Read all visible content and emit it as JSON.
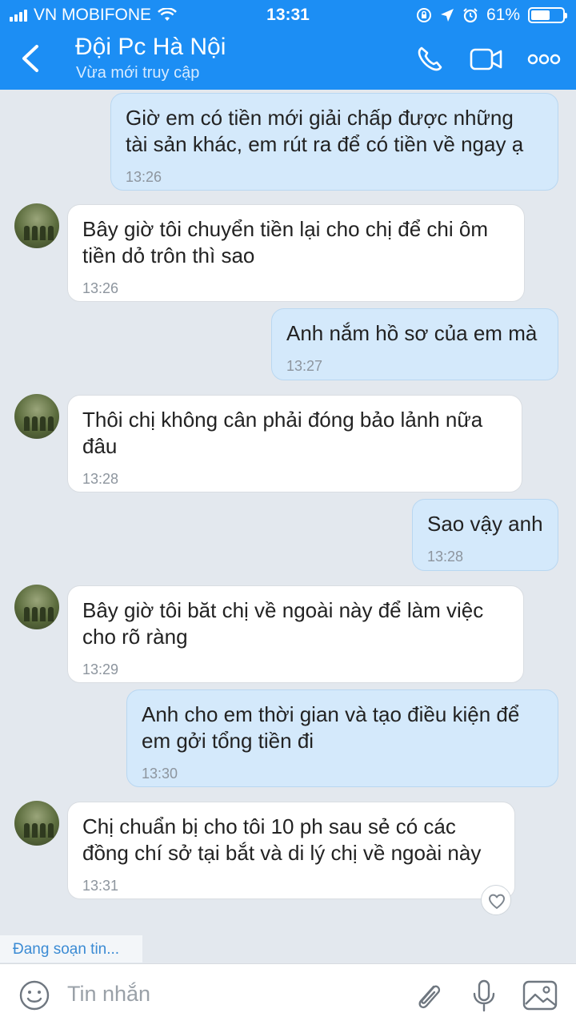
{
  "status": {
    "carrier": "VN MOBIFONE",
    "time": "13:31",
    "battery": "61%",
    "battery_level": 0.61
  },
  "header": {
    "title": "Đội  Pc Hà Nội",
    "subtitle": "Vừa mới truy cập"
  },
  "messages": [
    {
      "from": "me",
      "text": "Giờ em có tiền mới giải chấp được những\ntài sản khác, em rút ra để có tiền về ngay ạ",
      "time": "13:26"
    },
    {
      "from": "them",
      "text": "Bây giờ tôi chuyển tiền lại cho chị để chi ôm\ntiền dỏ trôn thì sao",
      "time": "13:26"
    },
    {
      "from": "me",
      "text": "Anh nắm hồ sơ của em mà",
      "time": "13:27"
    },
    {
      "from": "them",
      "text": "Thôi chị không cân phải đóng bảo lảnh nữa\nđâu",
      "time": "13:28"
    },
    {
      "from": "me",
      "text": "Sao vậy anh",
      "time": "13:28"
    },
    {
      "from": "them",
      "text": "Bây giờ tôi băt chị về ngoài này để làm việc\ncho rõ ràng",
      "time": "13:29"
    },
    {
      "from": "me",
      "text": "Anh cho em thời gian và tạo điều kiện để\nem gởi tổng tiền đi",
      "time": "13:30"
    },
    {
      "from": "them",
      "text": "Chị chuẩn bị cho tôi 10 ph sau  sẻ có các\nđồng chí sở tại bắt và di lý chị về ngoài này",
      "time": "13:31"
    }
  ],
  "typing_indicator": "Đang soạn tin...",
  "composer": {
    "placeholder": "Tin nhắn"
  },
  "colors": {
    "header": "#1c8ef4",
    "background": "#e3e8ee",
    "outgoing": "#d4e9fb",
    "incoming": "#ffffff"
  }
}
